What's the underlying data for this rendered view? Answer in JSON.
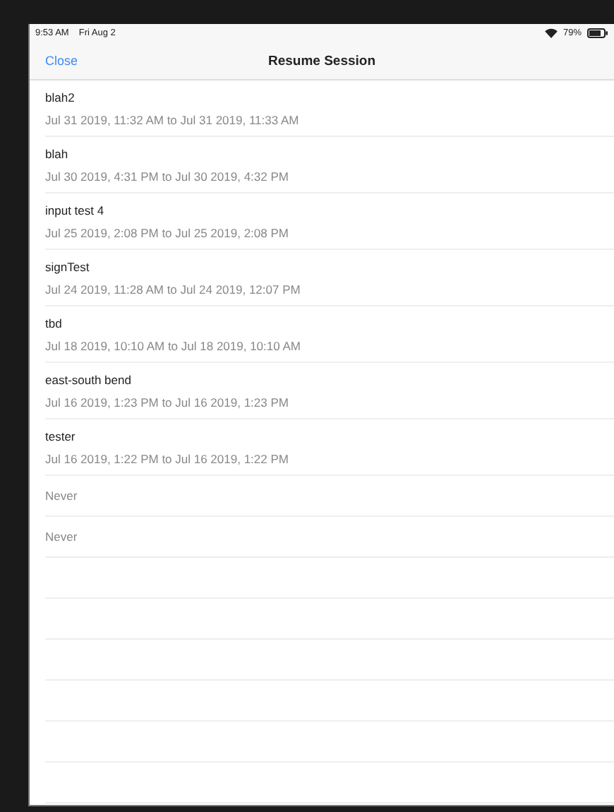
{
  "status_bar": {
    "time": "9:53 AM",
    "date": "Fri Aug 2",
    "battery": "79%"
  },
  "nav_bar": {
    "left_button": "Close",
    "title": "Resume Session"
  },
  "sessions": [
    {
      "kind": "session",
      "name": "blah2",
      "range": "Jul 31 2019, 11:32 AM to Jul 31 2019, 11:33 AM"
    },
    {
      "kind": "session",
      "name": "blah",
      "range": "Jul 30 2019, 4:31 PM to Jul 30 2019, 4:32 PM"
    },
    {
      "kind": "session",
      "name": "input test 4",
      "range": "Jul 25 2019, 2:08 PM to Jul 25 2019, 2:08 PM"
    },
    {
      "kind": "session",
      "name": "signTest",
      "range": "Jul 24 2019, 11:28 AM to Jul 24 2019, 12:07 PM"
    },
    {
      "kind": "session",
      "name": "tbd",
      "range": "Jul 18 2019, 10:10 AM to Jul 18 2019, 10:10 AM"
    },
    {
      "kind": "session",
      "name": "east-south bend",
      "range": "Jul 16 2019, 1:23 PM to Jul 16 2019, 1:23 PM"
    },
    {
      "kind": "session",
      "name": "tester",
      "range": "Jul 16 2019, 1:22 PM to Jul 16 2019, 1:22 PM"
    },
    {
      "kind": "never",
      "range": "Never"
    },
    {
      "kind": "never",
      "range": "Never"
    }
  ]
}
